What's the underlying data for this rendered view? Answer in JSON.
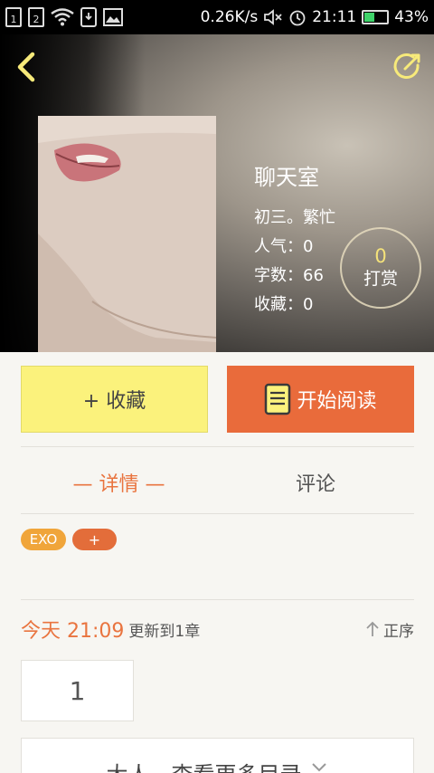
{
  "status_bar": {
    "sim1": "1",
    "sim2": "2",
    "speed": "0.26K/s",
    "time": "21:11",
    "battery": "43%",
    "battery_level": 0.43
  },
  "book": {
    "title": "聊天室",
    "author": "初三。繁忙",
    "popularity": "人气：0",
    "word_count": "字数：66",
    "favorites": "收藏：0"
  },
  "reward": {
    "count": "0",
    "label": "打赏"
  },
  "actions": {
    "collect_label": "+ 收藏",
    "read_label": "开始阅读"
  },
  "tabs": {
    "detail": "— 详情 —",
    "comment": "评论"
  },
  "tags": {
    "exo": "EXO",
    "add": "+"
  },
  "update": {
    "time": "今天 21:09",
    "text": "更新到1章",
    "sort_label": "正序"
  },
  "chapters": {
    "first": "1",
    "more_label": "大人，查看更多目录"
  },
  "colors": {
    "accent": "#e9743f",
    "collect_bg": "#fbf27c",
    "read_bg": "#e96b3b"
  }
}
